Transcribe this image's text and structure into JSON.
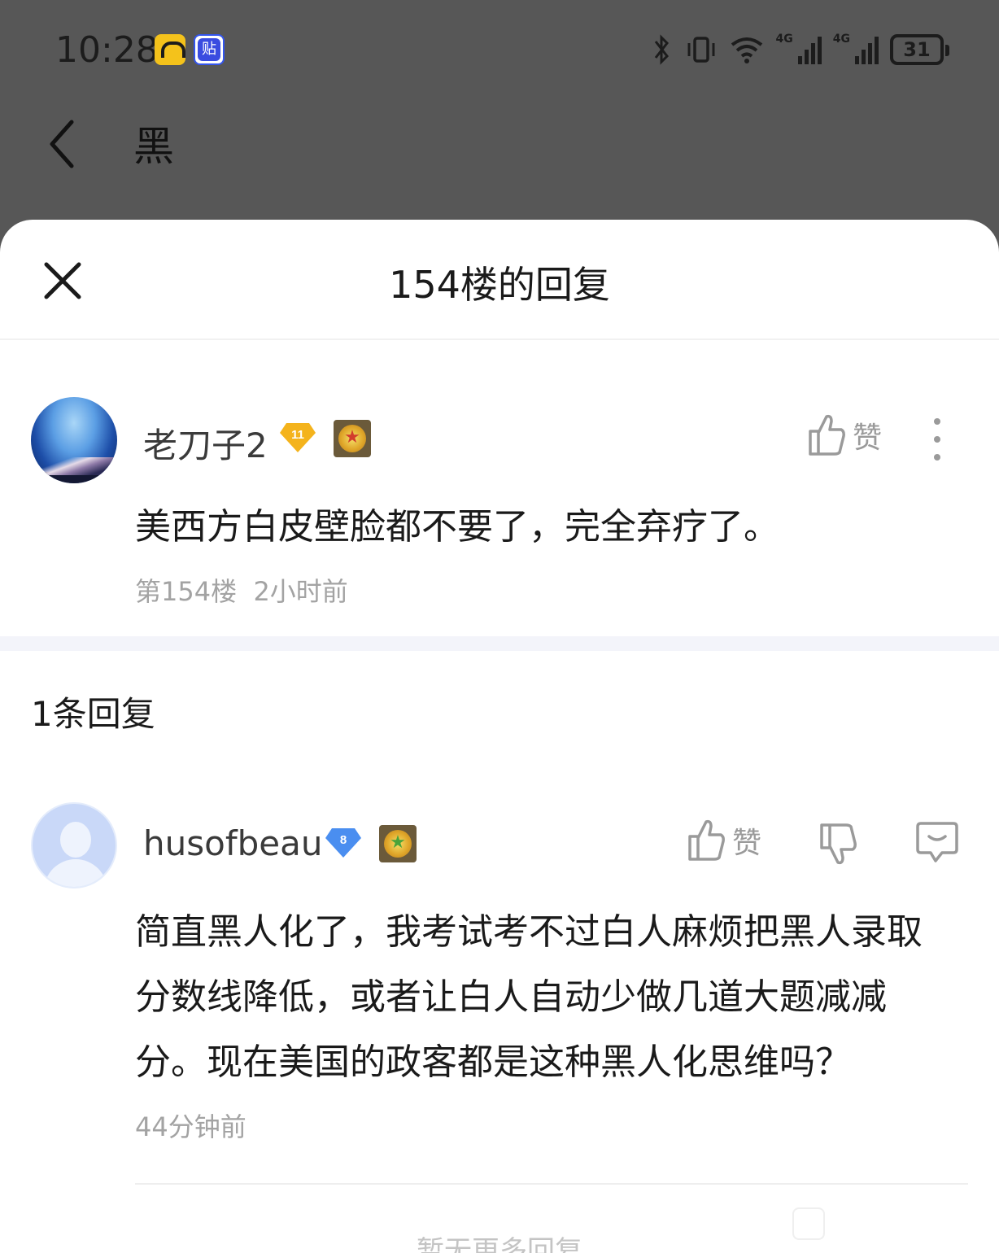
{
  "status_bar": {
    "time": "10:28",
    "tieba_badge": "贴",
    "net1": "4G",
    "net2": "4G",
    "battery": "31"
  },
  "app_bar": {
    "title": "黑"
  },
  "sheet": {
    "title": "154楼的回复"
  },
  "main_post": {
    "username": "老刀子2",
    "level": "11",
    "like_label": "赞",
    "content": "美西方白皮壁脸都不要了，完全弃疗了。",
    "floor": "第154楼",
    "time": "2小时前"
  },
  "replies_header": "1条回复",
  "reply": {
    "username": "husofbeau",
    "level": "8",
    "like_label": "赞",
    "content": "简直黑人化了，我考试考不过白人麻烦把黑人录取分数线降低，或者让白人自动少做几道大题减减分。现在美国的政客都是这种黑人化思维吗？",
    "time": "44分钟前"
  },
  "footer": {
    "no_more": "暂无更多回复"
  },
  "colors": {
    "dim_overlay": "#575757",
    "level_gold": "#f4b31c",
    "level_blue": "#4a8ef0",
    "meta_gray": "#a3a3a3"
  }
}
